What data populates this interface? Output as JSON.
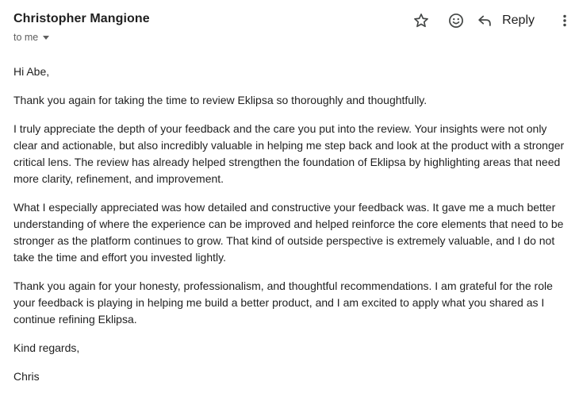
{
  "header": {
    "sender_name": "Christopher Mangione",
    "recipient": "to me",
    "reply_label": "Reply"
  },
  "icons": {
    "star": "star-icon",
    "emoji": "emoji-icon",
    "reply": "reply-icon",
    "more": "more-vert-icon",
    "caret": "chevron-down-icon"
  },
  "body": {
    "greeting": "Hi Abe,",
    "paragraphs": [
      "Thank you again for taking the time to review Eklipsa so thoroughly and thoughtfully.",
      "I truly appreciate the depth of your feedback and the care you put into the review. Your insights were not only clear and actionable, but also incredibly valuable in helping me step back and look at the product with a stronger critical lens. The review has already helped strengthen the foundation of Eklipsa by highlighting areas that need more clarity, refinement, and improvement.",
      "What I especially appreciated was how detailed and constructive your feedback was. It gave me a much better understanding of where the experience can be improved and helped reinforce the core elements that need to be stronger as the platform continues to grow. That kind of outside perspective is extremely valuable, and I do not take the time and effort you invested lightly.",
      "Thank you again for your honesty, professionalism, and thoughtful recommendations. I am grateful for the role your feedback is playing in helping me build a better product, and I am excited to apply what you shared as I continue refining Eklipsa."
    ],
    "closing": "Kind regards,",
    "signature": "Chris"
  },
  "colors": {
    "text": "#1f1f1f",
    "muted": "#5e5e5e",
    "icon": "#444746"
  }
}
